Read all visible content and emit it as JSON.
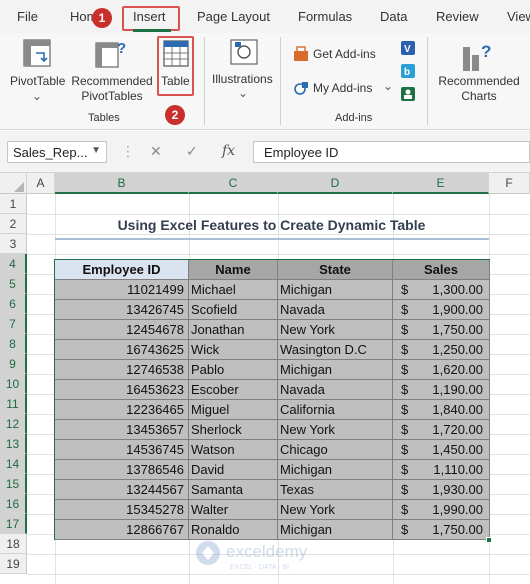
{
  "menu": {
    "file": "File",
    "home": "Home",
    "insert": "Insert",
    "page_layout": "Page Layout",
    "formulas": "Formulas",
    "data": "Data",
    "review": "Review",
    "view": "View"
  },
  "badges": {
    "one": "1",
    "two": "2"
  },
  "ribbon": {
    "pivot_table": "PivotTable",
    "recommended_pivot_line1": "Recommended",
    "recommended_pivot_line2": "PivotTables",
    "table": "Table",
    "tables_group": "Tables",
    "illustrations": "Illustrations",
    "get_addins": "Get Add-ins",
    "my_addins": "My Add-ins",
    "addins_group": "Add-ins",
    "recommended_charts_line1": "Recommended",
    "recommended_charts_line2": "Charts"
  },
  "formula_bar": {
    "name_box": "Sales_Rep...",
    "fx": "fx",
    "content": "Employee ID"
  },
  "columns": [
    "A",
    "B",
    "C",
    "D",
    "E",
    "F"
  ],
  "rows": [
    "1",
    "2",
    "3",
    "4",
    "5",
    "6",
    "7",
    "8",
    "9",
    "10",
    "11",
    "12",
    "13",
    "14",
    "15",
    "16",
    "17",
    "18",
    "19"
  ],
  "title": "Using Excel Features to Create Dynamic Table",
  "table": {
    "headers": [
      "Employee ID",
      "Name",
      "State",
      "Sales"
    ],
    "rows": [
      [
        "11021499",
        "Michael",
        "Michigan",
        "$",
        "1,300.00"
      ],
      [
        "13426745",
        "Scofield",
        "Navada",
        "$",
        "1,900.00"
      ],
      [
        "12454678",
        "Jonathan",
        "New York",
        "$",
        "1,750.00"
      ],
      [
        "16743625",
        "Wick",
        "Wasington D.C",
        "$",
        "1,250.00"
      ],
      [
        "12746538",
        "Pablo",
        "Michigan",
        "$",
        "1,620.00"
      ],
      [
        "16453623",
        "Escober",
        "Navada",
        "$",
        "1,190.00"
      ],
      [
        "12236465",
        "Miguel",
        "California",
        "$",
        "1,840.00"
      ],
      [
        "13453657",
        "Sherlock",
        "New York",
        "$",
        "1,720.00"
      ],
      [
        "14536745",
        "Watson",
        "Chicago",
        "$",
        "1,450.00"
      ],
      [
        "13786546",
        "David",
        "Michigan",
        "$",
        "1,110.00"
      ],
      [
        "13244567",
        "Samanta",
        "Texas",
        "$",
        "1,930.00"
      ],
      [
        "15345278",
        "Walter",
        "New York",
        "$",
        "1,990.00"
      ],
      [
        "12866767",
        "Ronaldo",
        "Michigan",
        "$",
        "1,750.00"
      ]
    ]
  },
  "watermark": {
    "name": "exceldemy",
    "tagline": "EXCEL · DATA · BI"
  },
  "colors": {
    "accent": "#1e7145",
    "badge": "#c9302c",
    "header_blue": "#dae3f0",
    "header_gray": "#a6a6a6",
    "body_gray": "#bfbfbf"
  }
}
